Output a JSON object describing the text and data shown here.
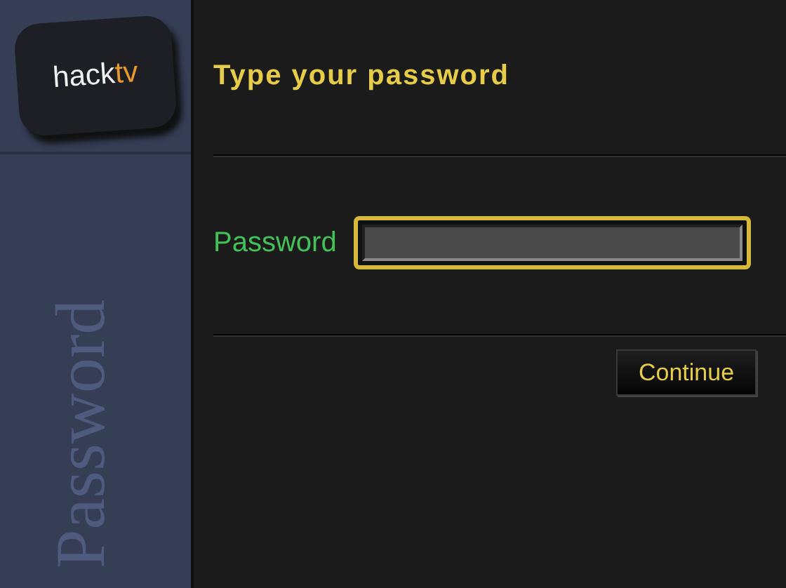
{
  "logo": {
    "text": "hack",
    "accent": "tv"
  },
  "sidebar": {
    "title": "Password"
  },
  "heading": "Type your password",
  "form": {
    "label": "Password"
  },
  "buttons": [
    "Continue"
  ]
}
